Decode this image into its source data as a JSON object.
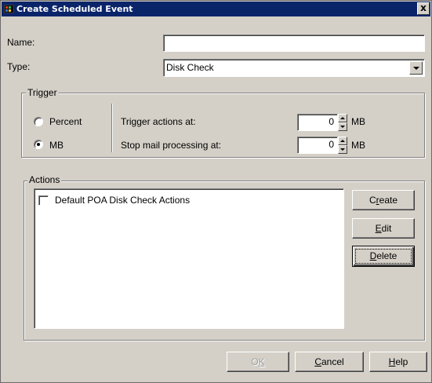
{
  "window": {
    "title": "Create Scheduled Event",
    "close_label": "x",
    "icon": "app-icon"
  },
  "form": {
    "name_label": "Name:",
    "name_value": "",
    "type_label": "Type:",
    "type_value": "Disk Check"
  },
  "trigger": {
    "legend": "Trigger",
    "percent_label": "Percent",
    "percent_selected": false,
    "mb_label": "MB",
    "mb_selected": true,
    "trigger_label": "Trigger actions at:",
    "trigger_value": "0",
    "trigger_unit": "MB",
    "stop_label": "Stop mail processing at:",
    "stop_value": "0",
    "stop_unit": "MB"
  },
  "actions": {
    "legend": "Actions",
    "items": [
      {
        "label": "Default POA Disk Check Actions",
        "checked": false
      }
    ],
    "create_pre": "C",
    "create_mn": "r",
    "create_post": "eate",
    "edit_pre": "",
    "edit_mn": "E",
    "edit_post": "dit",
    "delete_pre": "",
    "delete_mn": "D",
    "delete_post": "elete"
  },
  "footer": {
    "ok_pre": "O",
    "ok_mn": "K",
    "ok_post": "",
    "ok_enabled": false,
    "cancel_pre": "",
    "cancel_mn": "C",
    "cancel_post": "ancel",
    "help_pre": "",
    "help_mn": "H",
    "help_post": "elp"
  },
  "colors": {
    "titlebar": "#0a246a",
    "face": "#d4d0c8"
  }
}
